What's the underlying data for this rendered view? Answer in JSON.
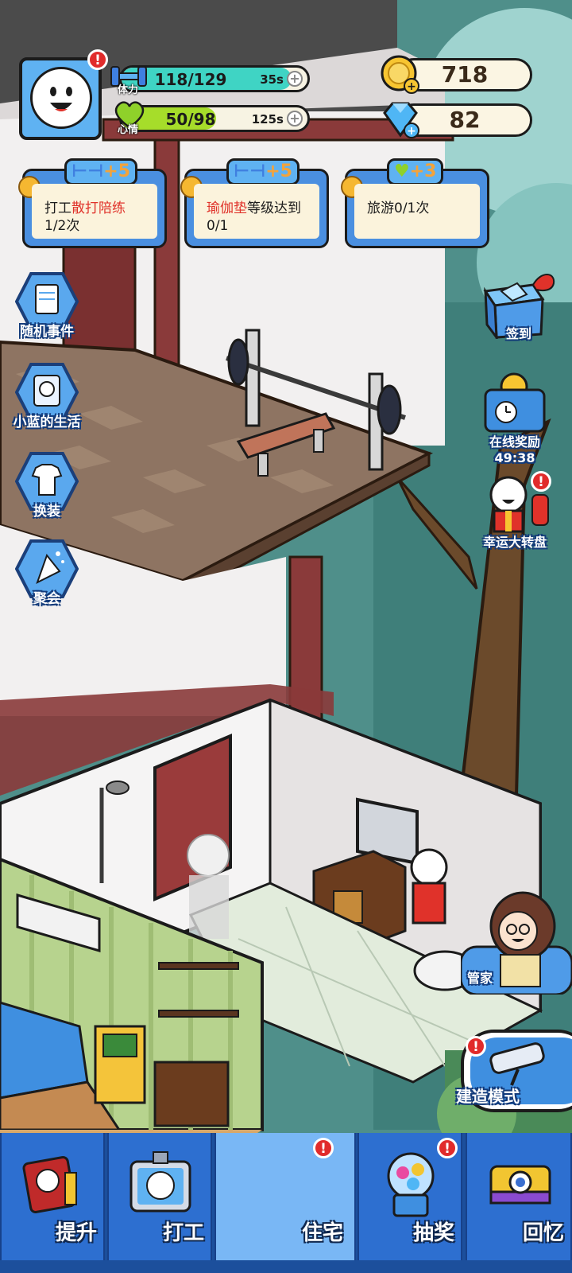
{
  "player": {
    "stamina": {
      "label": "体力",
      "value": "118/129",
      "fraction": 0.915,
      "timer": "35s",
      "color": "#3fd4c4"
    },
    "mood": {
      "label": "心情",
      "value": "50/98",
      "fraction": 0.51,
      "timer": "125s",
      "color": "#a6dd2a"
    },
    "coins": "718",
    "gems": "82"
  },
  "tasks": [
    {
      "reward": "+5",
      "reward_icon": "dumbbell-icon",
      "text_pre": "打工",
      "text_highlight": "散打陪练",
      "text_post": "",
      "progress": "1/2次"
    },
    {
      "reward": "+5",
      "reward_icon": "dumbbell-icon",
      "text_pre": "",
      "text_highlight": "瑜伽垫",
      "text_post": "等级达到",
      "progress": "0/1"
    },
    {
      "reward": "+3",
      "reward_icon": "heart-icon",
      "text_pre": "旅游0/1次",
      "text_highlight": "",
      "text_post": "",
      "progress": ""
    }
  ],
  "left_menu": [
    {
      "label": "随机事件",
      "icon": "notepad-icon"
    },
    {
      "label": "小蓝的生活",
      "icon": "diary-icon"
    },
    {
      "label": "换装",
      "icon": "shirt-icon"
    },
    {
      "label": "聚会",
      "icon": "party-popper-icon"
    }
  ],
  "right_menu": {
    "signin": "签到",
    "online_reward": "在线奖励",
    "online_timer": "49:38",
    "lucky_wheel": "幸运大转盘",
    "butler": "管家",
    "build_mode": "建造模式"
  },
  "bottom_nav": [
    {
      "label": "提升",
      "icon": "book-icon",
      "badge": false,
      "active": false
    },
    {
      "label": "打工",
      "icon": "id-badge-icon",
      "badge": false,
      "active": false
    },
    {
      "label": "住宅",
      "icon": "house-icon",
      "badge": true,
      "active": true
    },
    {
      "label": "抽奖",
      "icon": "gacha-machine-icon",
      "badge": true,
      "active": false
    },
    {
      "label": "回忆",
      "icon": "camera-icon",
      "badge": false,
      "active": false
    }
  ],
  "alert_mark": "!",
  "colors": {
    "brand_blue": "#2d6fd0",
    "alert_red": "#e12b2b",
    "highlight_red": "#e0322a"
  }
}
